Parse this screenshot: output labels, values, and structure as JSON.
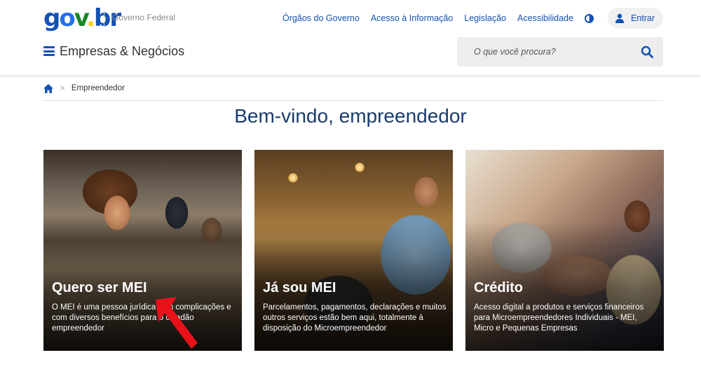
{
  "header": {
    "logo": {
      "g": "g",
      "o": "o",
      "v": "v",
      "dot": ".",
      "br": "br"
    },
    "gov_label": "Governo Federal",
    "links": [
      "Órgãos do Governo",
      "Acesso à Informação",
      "Legislação",
      "Acessibilidade"
    ],
    "login_label": "Entrar",
    "site_title": "Empresas & Negócios"
  },
  "search": {
    "placeholder": "O que você procura?"
  },
  "breadcrumb": {
    "current": "Empreendedor"
  },
  "page_title": "Bem-vindo, empreendedor",
  "cards": [
    {
      "title": "Quero ser MEI",
      "description": "O MEI é uma pessoa jurídica sem complicações e com diversos benefícios para o cidadão empreendedor"
    },
    {
      "title": "Já sou MEI",
      "description": "Parcelamentos, pagamentos, declarações e muitos outros serviços estão bem aqui, totalmente à disposição do Microempreendedor"
    },
    {
      "title": "Crédito",
      "description": "Acesso digital a produtos e serviços financeiros para Microempreendedores Individuais - MEI, Micro e Pequenas Empresas"
    }
  ],
  "colors": {
    "primary": "#1351b4",
    "title": "#1a3c6b",
    "arrow": "#e8111a"
  },
  "icons": [
    "menu-icon",
    "search-icon",
    "home-icon",
    "user-icon",
    "contrast-icon"
  ]
}
